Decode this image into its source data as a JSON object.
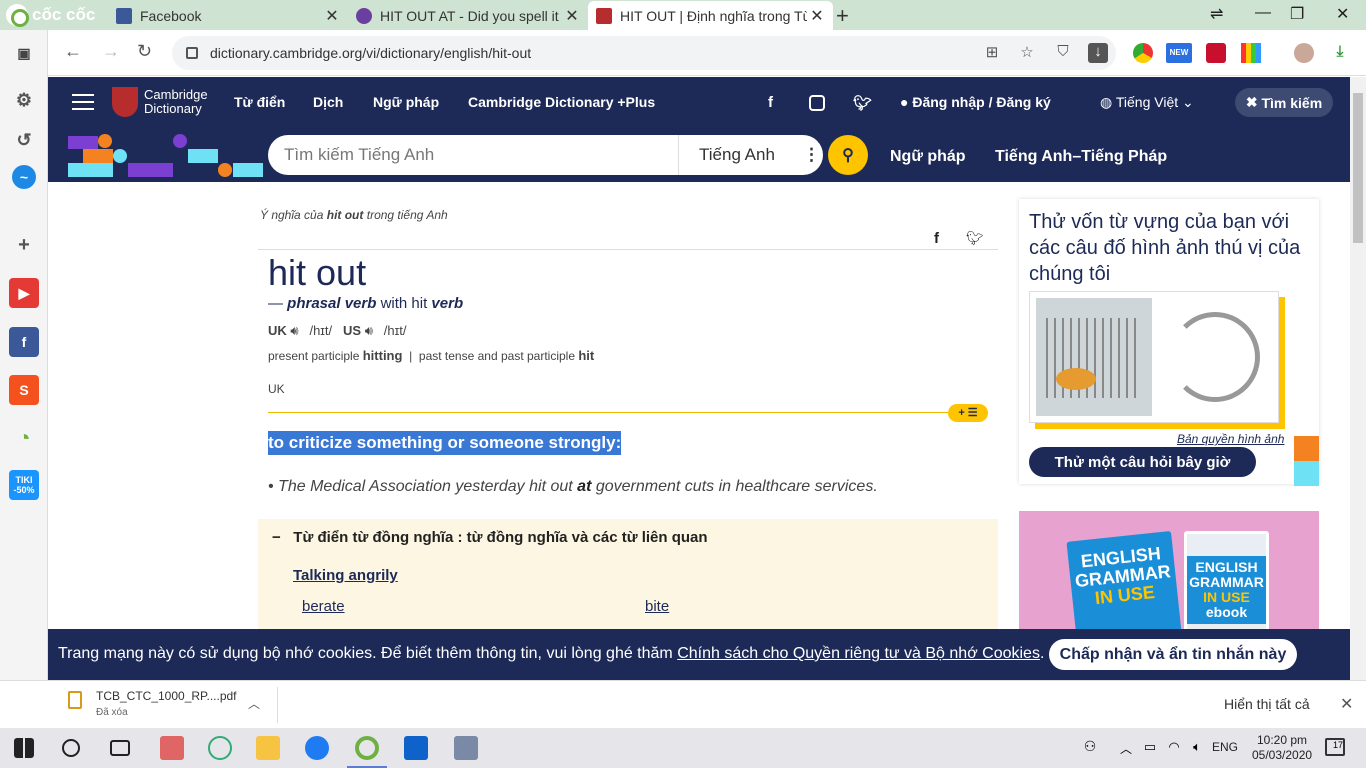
{
  "browser": {
    "brand": "cốc cốc",
    "tabs": [
      {
        "title": "Facebook",
        "favicon_color": "#3b5998"
      },
      {
        "title": "HIT OUT AT - Did you spell it",
        "favicon_color": "#6a3fa0"
      },
      {
        "title": "HIT OUT | Định nghĩa trong Từ",
        "favicon_color": "#b72c2c",
        "active": true
      }
    ],
    "url": "dictionary.cambridge.org/vi/dictionary/english/hit-out",
    "toolbar_badge": "NEW"
  },
  "site": {
    "logo_line1": "Cambridge",
    "logo_line2": "Dictionary",
    "nav": [
      "Từ điển",
      "Dịch",
      "Ngữ pháp",
      "Cambridge Dictionary +Plus"
    ],
    "login": "Đăng nhập / Đăng ký",
    "language": "Tiếng Việt",
    "search_button": "Tìm kiếm",
    "search_placeholder": "Tìm kiếm Tiếng Anh",
    "search_language": "Tiếng Anh",
    "sublinks": [
      "Ngữ pháp",
      "Tiếng Anh–Tiếng Pháp"
    ]
  },
  "entry": {
    "meaning_prefix": "Ý nghĩa của",
    "meaning_word": "hit out",
    "meaning_suffix": "trong tiếng Anh",
    "headword": "hit out",
    "pos_dash": "—",
    "pos": "phrasal verb",
    "pos_with": "with hit",
    "pos_verb": "verb",
    "uk_label": "UK",
    "uk_ipa": "/hɪt/",
    "us_label": "US",
    "us_ipa": "/hɪt/",
    "present_participle_label": "present participle",
    "present_participle": "hitting",
    "past_label": "past tense and past participle",
    "past": "hit",
    "region": "UK",
    "def_badge": "+ ☰",
    "definition": "to criticize something or someone strongly:",
    "example_before": "The Medical Association yesterday hit out",
    "example_bold": "at",
    "example_after": "government cuts in healthcare services.",
    "thesaurus_toggle": "−",
    "thesaurus_heading": "Từ điển từ đồng nghĩa : từ đồng nghĩa và các từ liên quan",
    "thesaurus_subheading": "Talking angrily",
    "thesaurus_words": [
      "berate",
      "bite"
    ]
  },
  "quiz": {
    "title": "Thử vốn từ vựng của bạn với các câu đố hình ảnh thú vị của chúng tôi",
    "copyright": "Bản quyền hình ảnh",
    "button": "Thử một câu hỏi bây giờ"
  },
  "ad": {
    "book1_line1": "ENGLISH",
    "book1_line2": "GRAMMAR",
    "book1_line3": "IN USE",
    "book2_line1": "ENGLISH",
    "book2_line2": "GRAMMAR",
    "book2_line3": "IN USE",
    "book2_line4": "ebook"
  },
  "cookie": {
    "text_before": "Trang mạng này có sử dụng bộ nhớ cookies. Để biết thêm thông tin, vui lòng ghé thăm",
    "link": "Chính sách cho Quyền riêng tư và Bộ nhớ Cookies",
    "text_after": ".",
    "button": "Chấp nhận và ẩn tin nhắn này"
  },
  "download": {
    "filename": "TCB_CTC_1000_RP....pdf",
    "status": "Đã xóa",
    "show_all": "Hiển thị tất cả"
  },
  "taskbar": {
    "language": "ENG",
    "time": "10:20 pm",
    "date": "05/03/2020",
    "notifications": "17"
  },
  "sidebar_apps": {
    "tiki_label": "TIKI",
    "tiki_discount": "-50%"
  }
}
